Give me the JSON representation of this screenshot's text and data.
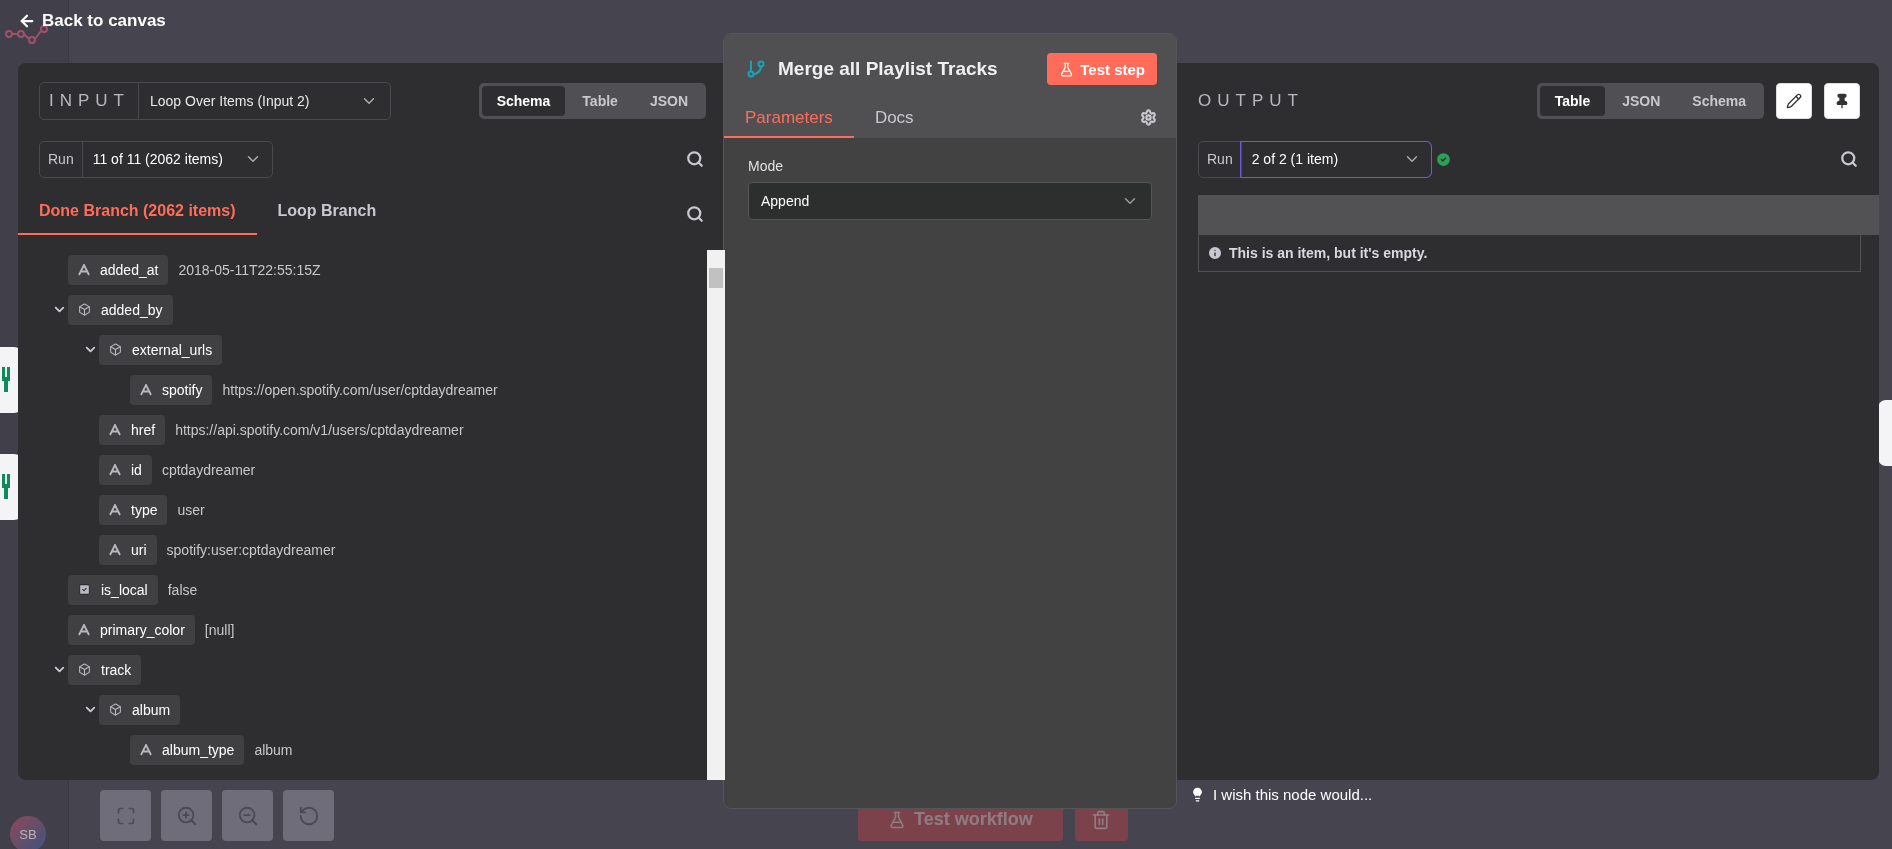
{
  "header": {
    "back_label": "Back to canvas"
  },
  "input_panel": {
    "label": "INPUT",
    "source": "Loop Over Items (Input 2)",
    "views": [
      {
        "label": "Schema",
        "selected": true
      },
      {
        "label": "Table",
        "selected": false
      },
      {
        "label": "JSON",
        "selected": false
      }
    ],
    "run": {
      "label": "Run",
      "value": "11 of 11 (2062 items)"
    },
    "branches": [
      {
        "label": "Done Branch (2062 items)",
        "selected": true
      },
      {
        "label": "Loop Branch",
        "selected": false
      }
    ],
    "schema": [
      {
        "kind": "string",
        "key": "added_at",
        "value": "2018-05-11T22:55:15Z"
      },
      {
        "kind": "object",
        "key": "added_by",
        "expanded": true,
        "children": [
          {
            "kind": "object",
            "key": "external_urls",
            "expanded": true,
            "children": [
              {
                "kind": "string",
                "key": "spotify",
                "value": "https://open.spotify.com/user/cptdaydreamer"
              }
            ]
          },
          {
            "kind": "string",
            "key": "href",
            "value": "https://api.spotify.com/v1/users/cptdaydreamer"
          },
          {
            "kind": "string",
            "key": "id",
            "value": "cptdaydreamer"
          },
          {
            "kind": "string",
            "key": "type",
            "value": "user"
          },
          {
            "kind": "string",
            "key": "uri",
            "value": "spotify:user:cptdaydreamer"
          }
        ]
      },
      {
        "kind": "boolean",
        "key": "is_local",
        "value": "false"
      },
      {
        "kind": "string",
        "key": "primary_color",
        "value": "[null]"
      },
      {
        "kind": "object",
        "key": "track",
        "expanded": true,
        "children": [
          {
            "kind": "object",
            "key": "album",
            "expanded": true,
            "children": [
              {
                "kind": "string",
                "key": "album_type",
                "value": "album"
              }
            ]
          }
        ]
      }
    ]
  },
  "node_panel": {
    "title": "Merge all Playlist Tracks",
    "test_button": "Test step",
    "tabs": [
      {
        "label": "Parameters",
        "selected": true
      },
      {
        "label": "Docs",
        "selected": false
      }
    ],
    "parameters": [
      {
        "label": "Mode",
        "value": "Append"
      }
    ]
  },
  "output_panel": {
    "label": "OUTPUT",
    "views": [
      {
        "label": "Table",
        "selected": true
      },
      {
        "label": "JSON",
        "selected": false
      },
      {
        "label": "Schema",
        "selected": false
      }
    ],
    "run": {
      "label": "Run",
      "value": "2 of 2 (1 item)"
    },
    "empty_message": "This is an item, but it's empty."
  },
  "feedback": "I wish this node would...",
  "canvas": {
    "test_workflow": "Test workflow",
    "avatar": "SB"
  }
}
